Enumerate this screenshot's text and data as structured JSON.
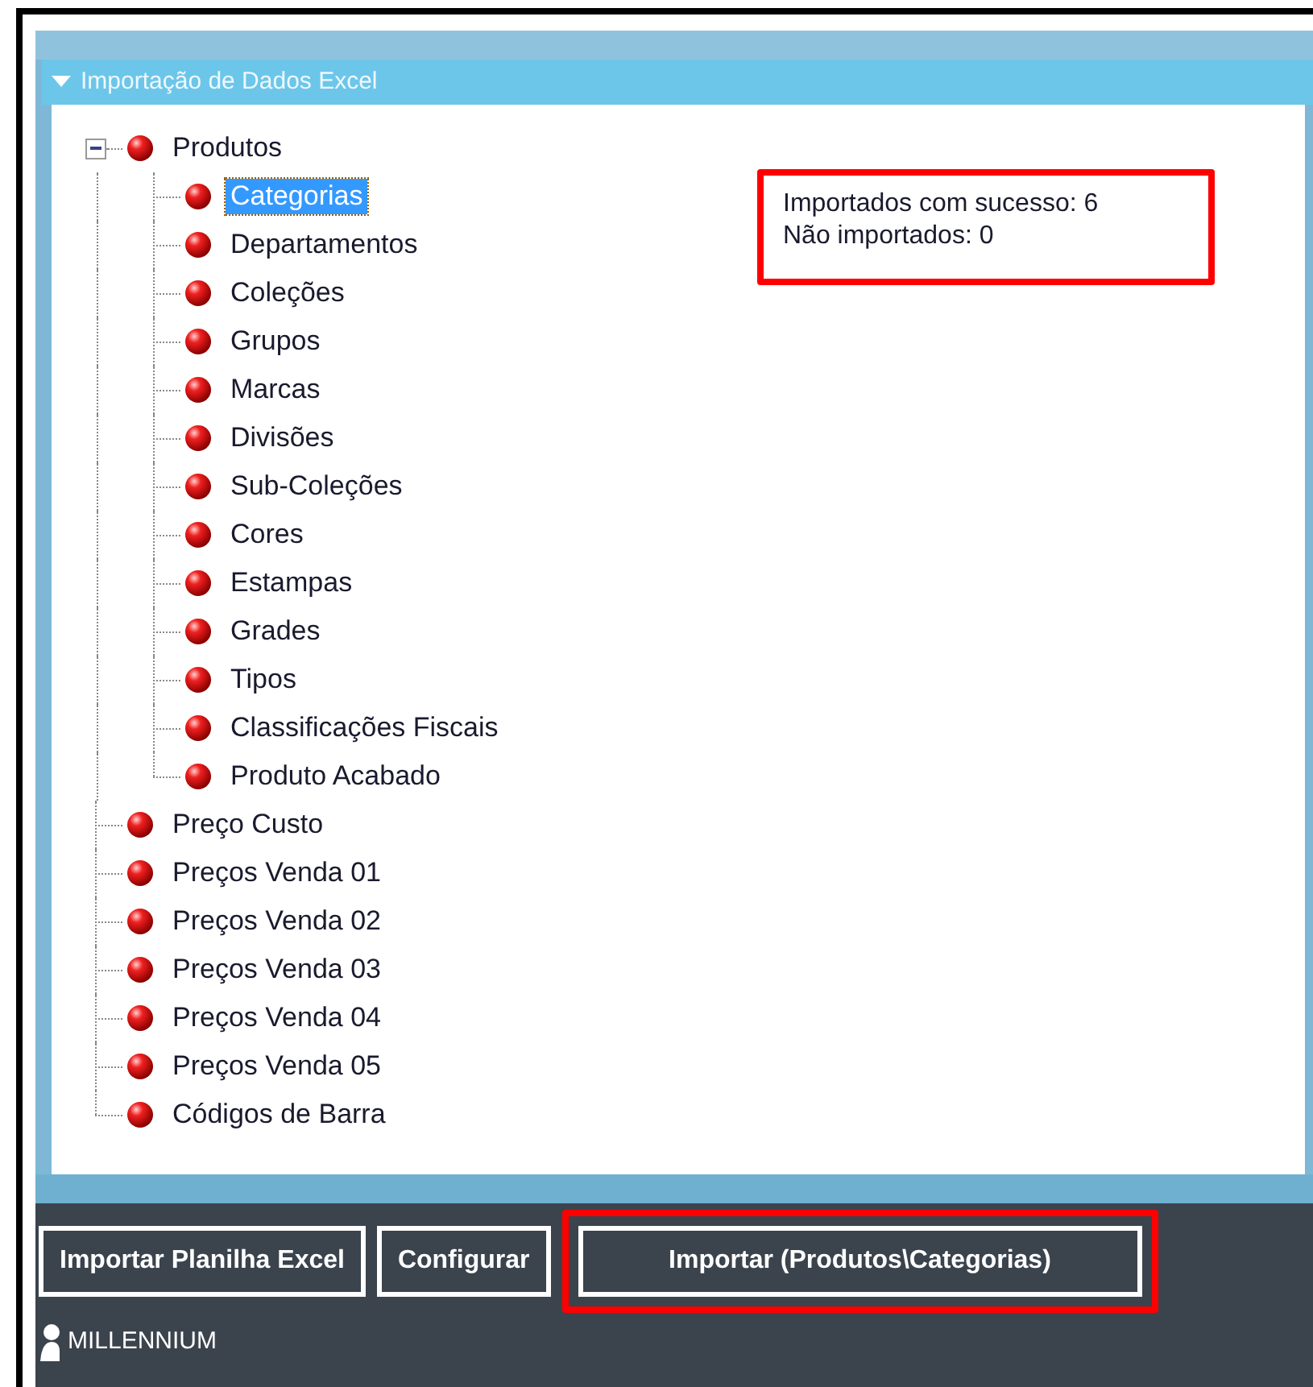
{
  "panel": {
    "title": "Importação de Dados Excel",
    "expanded": true
  },
  "tree": [
    {
      "label": "Produtos",
      "selected": false,
      "expanded": true,
      "children": [
        {
          "label": "Categorias",
          "selected": true
        },
        {
          "label": "Departamentos",
          "selected": false
        },
        {
          "label": "Coleções",
          "selected": false
        },
        {
          "label": "Grupos",
          "selected": false
        },
        {
          "label": "Marcas",
          "selected": false
        },
        {
          "label": "Divisões",
          "selected": false
        },
        {
          "label": "Sub-Coleções",
          "selected": false
        },
        {
          "label": "Cores",
          "selected": false
        },
        {
          "label": "Estampas",
          "selected": false
        },
        {
          "label": "Grades",
          "selected": false
        },
        {
          "label": "Tipos",
          "selected": false
        },
        {
          "label": "Classificações Fiscais",
          "selected": false
        },
        {
          "label": "Produto Acabado",
          "selected": false
        }
      ]
    },
    {
      "label": "Preço Custo",
      "selected": false
    },
    {
      "label": "Preços Venda 01",
      "selected": false
    },
    {
      "label": "Preços Venda 02",
      "selected": false
    },
    {
      "label": "Preços Venda 03",
      "selected": false
    },
    {
      "label": "Preços Venda 04",
      "selected": false
    },
    {
      "label": "Preços Venda 05",
      "selected": false
    },
    {
      "label": "Códigos de Barra",
      "selected": false
    }
  ],
  "summary": {
    "lines": [
      "Importados com sucesso: 6",
      "Não importados: 0"
    ],
    "highlighted": true
  },
  "buttons": [
    {
      "label": "Importar Planilha Excel",
      "highlighted": false
    },
    {
      "label": "Configurar",
      "highlighted": false
    },
    {
      "label": "Importar (Produtos\\Categorias)",
      "highlighted": true
    }
  ],
  "footer": {
    "brand": "MILLENNIUM"
  }
}
